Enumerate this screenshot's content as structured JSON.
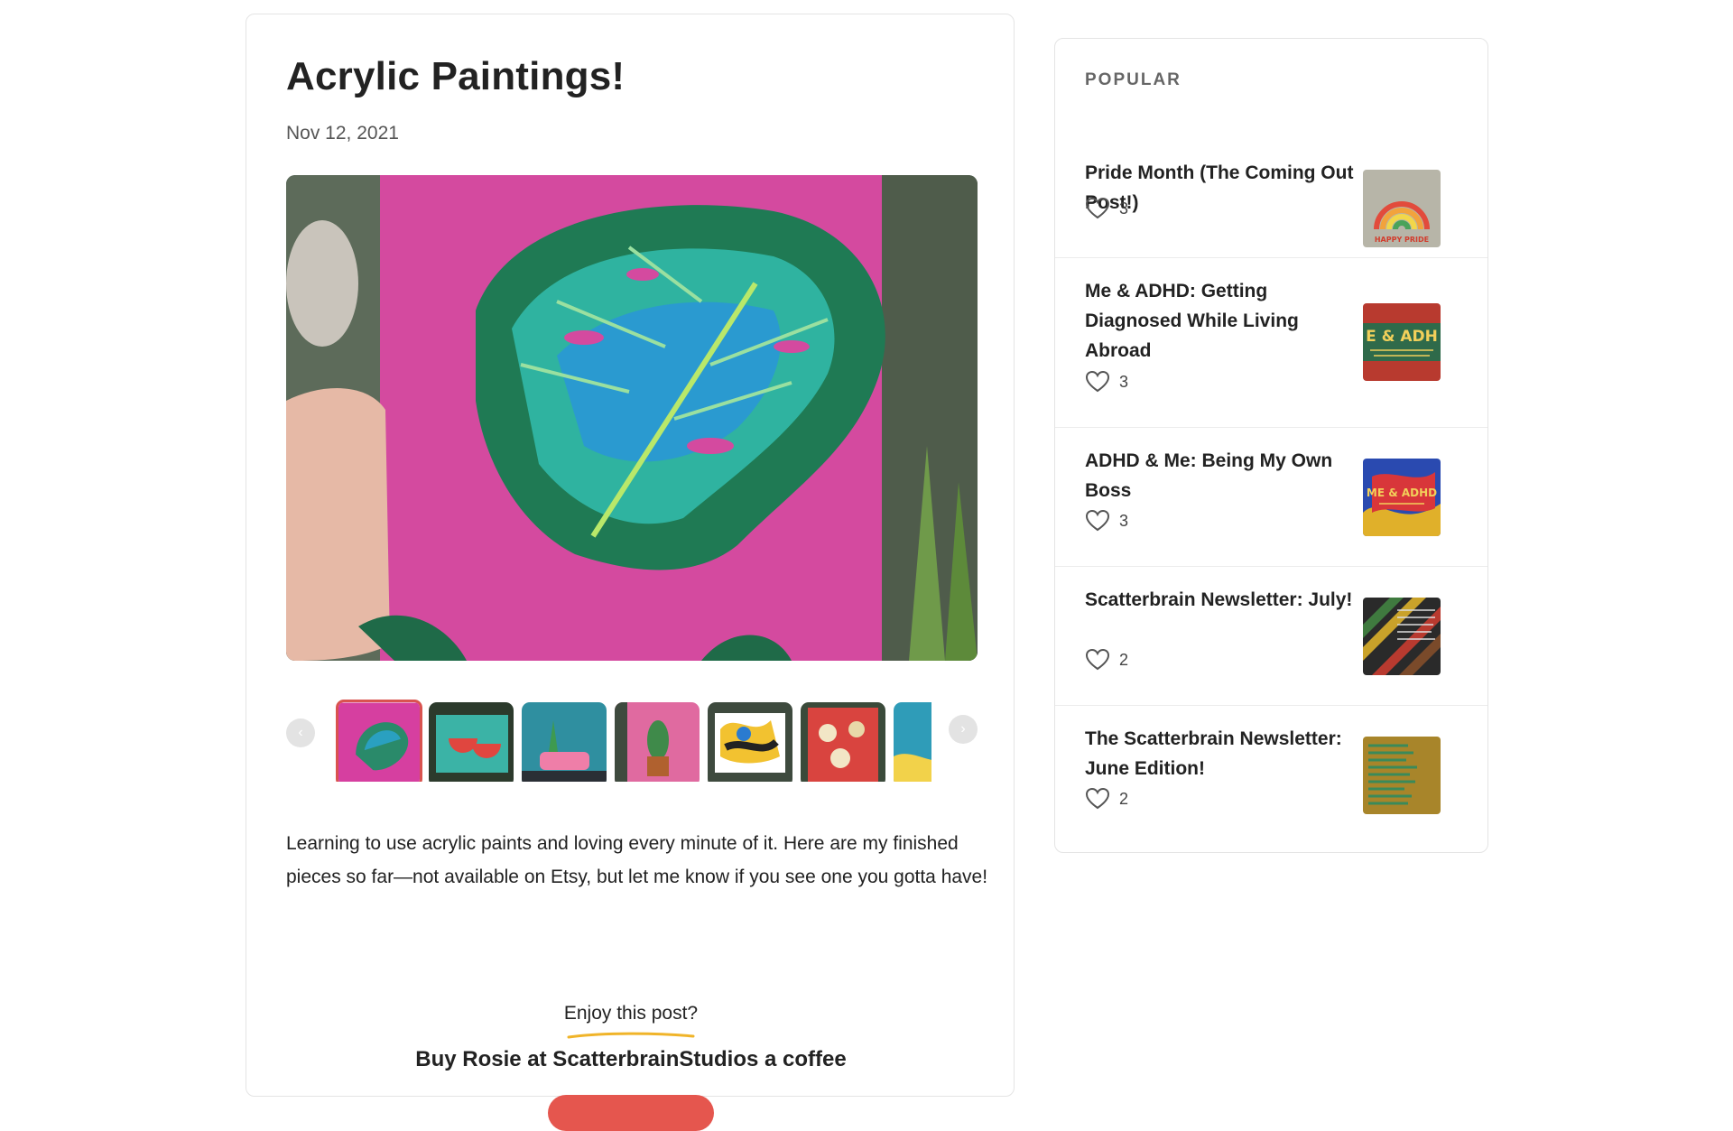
{
  "post": {
    "title": "Acrylic Paintings!",
    "date": "Nov 12, 2021",
    "body": "Learning to use acrylic paints and loving every minute of it. Here are my finished pieces so far—not available on Etsy, but let me know if you see one you gotta have!",
    "enjoy_prompt": "Enjoy this post?",
    "coffee_cta": "Buy Rosie at ScatterbrainStudios a coffee"
  },
  "gallery": {
    "prev_icon": "‹",
    "next_icon": "›",
    "selected_index": 0,
    "thumbnails": [
      {
        "subject": "monstera leaf on pink",
        "color": "#d63fa0"
      },
      {
        "subject": "watermelon slices",
        "color": "#3bb3a6"
      },
      {
        "subject": "pink sofa with plants",
        "color": "#2f8fa0"
      },
      {
        "subject": "cactus in pot",
        "color": "#e06aa0"
      },
      {
        "subject": "abstract shapes",
        "color": "#2b2b2b"
      },
      {
        "subject": "apples on red",
        "color": "#d9443f"
      },
      {
        "subject": "partial blue painting",
        "color": "#2f9cb8"
      }
    ]
  },
  "sidebar": {
    "heading": "POPULAR",
    "items": [
      {
        "title": "Pride Month (The Coming Out Post!)",
        "likes": "3",
        "thumb_label": "HAPPY PRIDE"
      },
      {
        "title": "Me & ADHD: Getting Diagnosed While Living Abroad",
        "likes": "3",
        "thumb_label": "E & ADH"
      },
      {
        "title": "ADHD & Me: Being My Own Boss",
        "likes": "3",
        "thumb_label": "ME & ADHD"
      },
      {
        "title": "Scatterbrain Newsletter: July!",
        "likes": "2",
        "thumb_label": ""
      },
      {
        "title": "The Scatterbrain Newsletter: June Edition!",
        "likes": "2",
        "thumb_label": ""
      }
    ]
  },
  "colors": {
    "accent": "#e5564e",
    "selected_border": "#d9534f",
    "underline": "#f0b429"
  }
}
